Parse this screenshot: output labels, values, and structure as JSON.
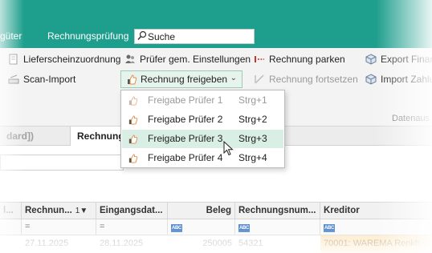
{
  "header": {
    "tab_partial": "güter",
    "tab_active": "Rechnungsprüfung",
    "search_placeholder": "Suche",
    "bg_color": "#1e9e8c"
  },
  "ribbon": {
    "lieferschein": "Lieferscheinzuordnung",
    "scan_import": "Scan-Import",
    "pruefer_einst": "Prüfer gem. Einstellungen",
    "rechnung_freigeben": "Rechnung freigeben",
    "rechnung_parken": "Rechnung parken",
    "rechnung_fortsetzen": "Rechnung fortsetzen",
    "export_fina": "Export Finan",
    "import_zahlu": "Import Zahlu",
    "group_datenaus": "Datenaus"
  },
  "menu": {
    "items": [
      {
        "label": "Freigabe Prüfer 1",
        "shortcut": "Strg+1",
        "enabled": false
      },
      {
        "label": "Freigabe Prüfer 2",
        "shortcut": "Strg+2",
        "enabled": true
      },
      {
        "label": "Freigabe Prüfer 3",
        "shortcut": "Strg+3",
        "enabled": true
      },
      {
        "label": "Freigabe Prüfer 4",
        "shortcut": "Strg+4",
        "enabled": true
      }
    ]
  },
  "doctabs": {
    "inactive": "dard])",
    "active": "Rechnung"
  },
  "grid": {
    "columns": [
      "l...",
      "Rechnun...",
      "Eingangsdat...",
      "Beleg",
      "Rechnungsnum...",
      "Kreditor"
    ],
    "sort_indicator": "1▼",
    "filter_eq": "=",
    "abc": "ABC",
    "row": {
      "rechnungsdatum": "27.11.2025",
      "eingangsdatum": "28.11.2025",
      "beleg": "250005",
      "rechnungsnummer": "54321",
      "kreditor": "70001: WAREMA Renkh"
    }
  }
}
